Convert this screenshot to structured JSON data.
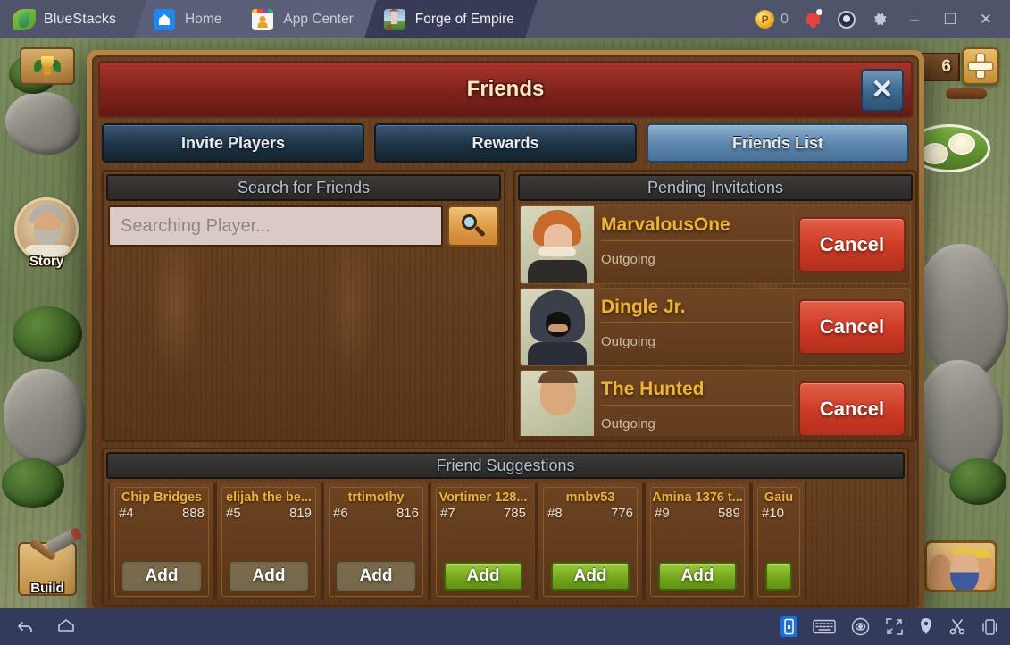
{
  "emulator": {
    "brand": "BlueStacks",
    "brand_icon": "bluestacks-logo-icon",
    "tabs": [
      {
        "label": "Home",
        "icon": "home-icon",
        "active": false
      },
      {
        "label": "App Center",
        "icon": "app-center-icon",
        "active": false
      },
      {
        "label": "Forge of Empire",
        "icon": "forge-of-empire-icon",
        "active": true
      }
    ],
    "system": {
      "coin_icon": "points-coin-icon",
      "coin_value": "0",
      "notification_icon": "bell-icon",
      "account_icon": "account-icon",
      "settings_icon": "gear-icon",
      "minimize": "–",
      "maximize": "☐",
      "close": "✕"
    }
  },
  "game_hud": {
    "trophy_icon": "trophy-icon",
    "story_label": "Story",
    "story_icon": "story-avatar-icon",
    "build_label": "Build",
    "build_icon": "hammer-icon",
    "resource_value": "6",
    "add_resource_icon": "plus-icon",
    "friends_hud_icon": "friends-hud-icon"
  },
  "dialog": {
    "title": "Friends",
    "close_icon": "close-icon",
    "tabs": [
      {
        "label": "Invite Players",
        "active": false
      },
      {
        "label": "Rewards",
        "active": false
      },
      {
        "label": "Friends List",
        "active": true
      }
    ],
    "search": {
      "header": "Search for Friends",
      "placeholder": "Searching Player...",
      "value": "",
      "button_icon": "magnifier-icon"
    },
    "pending": {
      "header": "Pending Invitations",
      "rows": [
        {
          "name": "MarvalousOne",
          "status": "Outgoing",
          "action": "Cancel",
          "avatar": "female-redhead-noble-icon"
        },
        {
          "name": "Dingle Jr.",
          "status": "Outgoing",
          "action": "Cancel",
          "avatar": "hooded-figure-icon"
        },
        {
          "name": "The Hunted",
          "status": "Outgoing",
          "action": "Cancel",
          "avatar": "bald-man-icon"
        }
      ]
    },
    "suggestions": {
      "header": "Friend Suggestions",
      "cards": [
        {
          "name": "Chip Bridges",
          "rank": "#4",
          "score": "888",
          "add_label": "Add",
          "add_enabled": false,
          "avatar": "hooded-figure-icon"
        },
        {
          "name": "elijah the be...",
          "rank": "#5",
          "score": "819",
          "add_label": "Add",
          "add_enabled": false,
          "avatar": "long-hair-man-icon"
        },
        {
          "name": "trtimothy",
          "rank": "#6",
          "score": "816",
          "add_label": "Add",
          "add_enabled": false,
          "avatar": "dark-hair-man-icon"
        },
        {
          "name": "Vortimer 128...",
          "rank": "#7",
          "score": "785",
          "add_label": "Add",
          "add_enabled": true,
          "avatar": "fur-collar-man-icon"
        },
        {
          "name": "mnbv53",
          "rank": "#8",
          "score": "776",
          "add_label": "Add",
          "add_enabled": true,
          "avatar": "braided-woman-icon"
        },
        {
          "name": "Amina 1376 t...",
          "rank": "#9",
          "score": "589",
          "add_label": "Add",
          "add_enabled": true,
          "avatar": "flower-crown-woman-icon"
        },
        {
          "name": "Gaiu",
          "rank": "#10",
          "score": "",
          "add_label": "",
          "add_enabled": true,
          "avatar": "armored-figure-icon"
        }
      ]
    }
  },
  "navbar": {
    "back_icon": "back-icon",
    "home_icon": "home-outline-icon",
    "right_icons": [
      "volume-icon",
      "keyboard-icon",
      "eye-icon",
      "fullscreen-icon",
      "location-icon",
      "scissors-icon",
      "shake-device-icon"
    ]
  },
  "colors": {
    "accent_gold": "#f0b429",
    "cancel_red": "#cf3c26",
    "add_green": "#76aa1f",
    "tab_active_blue": "#5d86ab",
    "title_red": "#7e231c",
    "wood_brown": "#6b4321"
  }
}
